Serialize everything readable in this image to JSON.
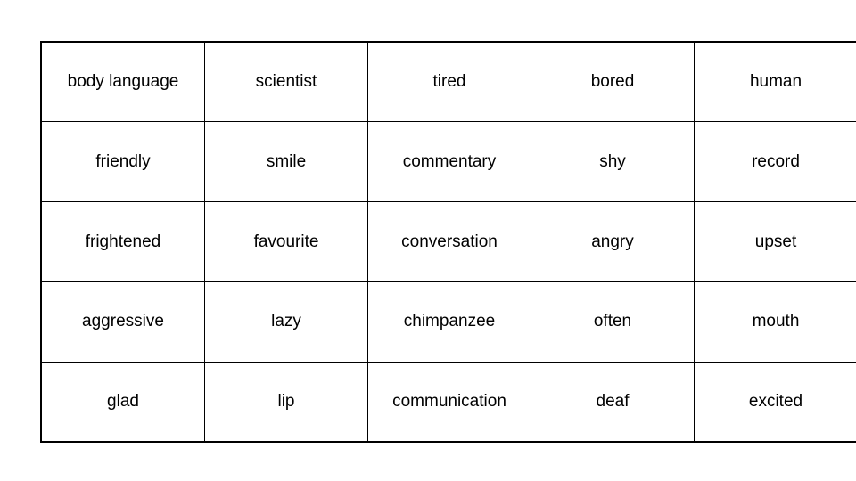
{
  "page": {
    "background_color": "#ffffff",
    "text_color": "#000000",
    "border_color": "#000000"
  },
  "grid": {
    "name": "vocabulary-word-grid",
    "rows": 5,
    "columns": 5,
    "cells": [
      [
        "body language",
        "scientist",
        "tired",
        "bored",
        "human"
      ],
      [
        "friendly",
        "smile",
        "commentary",
        "shy",
        "record"
      ],
      [
        "frightened",
        "favourite",
        "conversation",
        "angry",
        "upset"
      ],
      [
        "aggressive",
        "lazy",
        "chimpanzee",
        "often",
        "mouth"
      ],
      [
        "glad",
        "lip",
        "communication",
        "deaf",
        "excited"
      ]
    ]
  }
}
